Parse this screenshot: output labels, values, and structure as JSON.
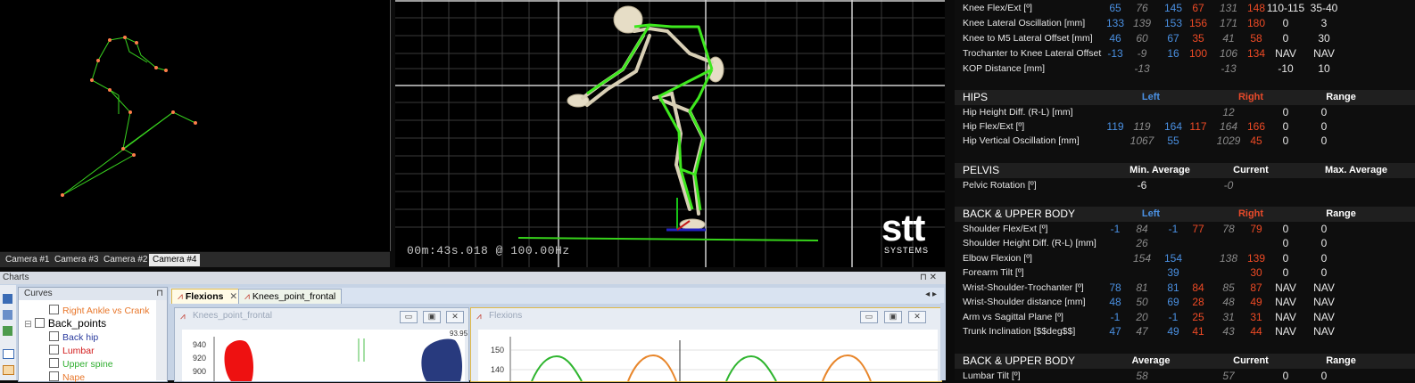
{
  "camera_tabs": [
    "Camera #1",
    "Camera #3",
    "Camera #2",
    "Camera #4"
  ],
  "active_camera": "Camera #4",
  "timecode": "00m:43s.018 @ 100.00Hz",
  "logo": {
    "main": "stt",
    "sub": "SYSTEMS"
  },
  "charts": {
    "panel_title": "Charts",
    "curves_header": "Curves",
    "curve_items": [
      {
        "label": "Right Ankle vs Crank",
        "color": "#e8772b",
        "indent": 1
      },
      {
        "label": "Back_points",
        "color": "#000000",
        "indent": 0,
        "group": true
      },
      {
        "label": "Back hip",
        "color": "#2a3b9e",
        "indent": 1
      },
      {
        "label": "Lumbar",
        "color": "#d21a1a",
        "indent": 1
      },
      {
        "label": "Upper spine",
        "color": "#2fae2f",
        "indent": 1
      },
      {
        "label": "Nape",
        "color": "#e8772b",
        "indent": 1
      }
    ],
    "tabs": [
      "Flexions",
      "Knees_point_frontal"
    ],
    "window_knees": {
      "title": "Knees_point_frontal",
      "y_ticks": [
        "940",
        "920",
        "900"
      ],
      "annotation": "93.95"
    },
    "window_flexions": {
      "title": "Flexions",
      "y_ticks": [
        "150",
        "140"
      ]
    }
  },
  "table": {
    "pre_rows": [
      {
        "label": "Knee Flex/Ext [º]",
        "l1": "65",
        "l2": "76",
        "l3": "145",
        "r1": "67",
        "r2": "131",
        "r3": "148",
        "g1": "110-115",
        "g2": "35-40"
      },
      {
        "label": "Knee Lateral Oscillation [mm]",
        "l1": "133",
        "l2": "139",
        "l3": "153",
        "r1": "156",
        "r2": "171",
        "r3": "180",
        "g1": "0",
        "g2": "3"
      },
      {
        "label": "Knee to M5 Lateral Offset [mm]",
        "l1": "46",
        "l2": "60",
        "l3": "67",
        "r1": "35",
        "r2": "41",
        "r3": "58",
        "g1": "0",
        "g2": "30"
      },
      {
        "label": "Trochanter to Knee Lateral Offset",
        "l1": "-13",
        "l2": "-9",
        "l3": "16",
        "r1": "100",
        "r2": "106",
        "r3": "134",
        "g1": "NAV",
        "g2": "NAV"
      },
      {
        "label": "KOP Distance [mm]",
        "l1": "",
        "l2": "-13",
        "l3": "",
        "r1": "",
        "r2": "-13",
        "r3": "",
        "g1": "-10",
        "g2": "10"
      }
    ],
    "hips": {
      "title": "HIPS",
      "left": "Left",
      "right": "Right",
      "range": "Range",
      "rows": [
        {
          "label": "Hip Height Diff. (R-L) [mm]",
          "l1": "",
          "l2": "",
          "l3": "",
          "r1": "",
          "r2": "12",
          "r3": "",
          "g1": "0",
          "g2": "0"
        },
        {
          "label": "Hip Flex/Ext [º]",
          "l1": "119",
          "l2": "119",
          "l3": "164",
          "r1": "117",
          "r2": "164",
          "r3": "166",
          "g1": "0",
          "g2": "0"
        },
        {
          "label": "Hip Vertical Oscillation [mm]",
          "l1": "",
          "l2": "1067",
          "l3": "55",
          "r1": "",
          "r2": "1029",
          "r3": "45",
          "g1": "0",
          "g2": "0"
        }
      ]
    },
    "pelvis": {
      "title": "PELVIS",
      "c1": "Min. Average",
      "c2": "Current",
      "c3": "Max. Average",
      "rows": [
        {
          "label": "Pelvic Rotation [º]",
          "v1": "-6",
          "v2": "-0",
          "v3": ""
        }
      ]
    },
    "back": {
      "title": "BACK & UPPER BODY",
      "left": "Left",
      "right": "Right",
      "range": "Range",
      "rows": [
        {
          "label": "Shoulder Flex/Ext [º]",
          "l1": "-1",
          "l2": "84",
          "l3": "-1",
          "r1": "77",
          "r2": "78",
          "r3": "79",
          "g1": "0",
          "g2": "0"
        },
        {
          "label": "Shoulder Height Diff. (R-L) [mm]",
          "l1": "",
          "l2": "26",
          "l3": "",
          "r1": "",
          "r2": "",
          "r3": "",
          "g1": "0",
          "g2": "0"
        },
        {
          "label": "Elbow Flexion [º]",
          "l1": "",
          "l2": "154",
          "l3": "154",
          "r1": "",
          "r2": "138",
          "r3": "139",
          "g1": "0",
          "g2": "0"
        },
        {
          "label": "Forearm Tilt [º]",
          "l1": "",
          "l2": "",
          "l3": "39",
          "r1": "",
          "r2": "",
          "r3": "30",
          "g1": "0",
          "g2": "0"
        },
        {
          "label": "Wrist-Shoulder-Trochanter [º]",
          "l1": "78",
          "l2": "81",
          "l3": "81",
          "r1": "84",
          "r2": "85",
          "r3": "87",
          "g1": "NAV",
          "g2": "NAV"
        },
        {
          "label": "Wrist-Shoulder distance [mm]",
          "l1": "48",
          "l2": "50",
          "l3": "69",
          "r1": "28",
          "r2": "48",
          "r3": "49",
          "g1": "NAV",
          "g2": "NAV"
        },
        {
          "label": "Arm vs Sagittal Plane [º]",
          "l1": "-1",
          "l2": "20",
          "l3": "-1",
          "r1": "25",
          "r2": "31",
          "r3": "31",
          "g1": "NAV",
          "g2": "NAV"
        },
        {
          "label": "Trunk Inclination [$$deg$$]",
          "l1": "47",
          "l2": "47",
          "l3": "49",
          "r1": "41",
          "r2": "43",
          "r3": "44",
          "g1": "NAV",
          "g2": "NAV"
        }
      ]
    },
    "back2": {
      "title": "BACK & UPPER BODY",
      "c1": "Average",
      "c2": "Current",
      "c3": "Range",
      "rows": [
        {
          "label": "Lumbar Tilt [º]",
          "v1": "58",
          "v2": "57",
          "g1": "0",
          "g2": "0"
        }
      ]
    }
  }
}
